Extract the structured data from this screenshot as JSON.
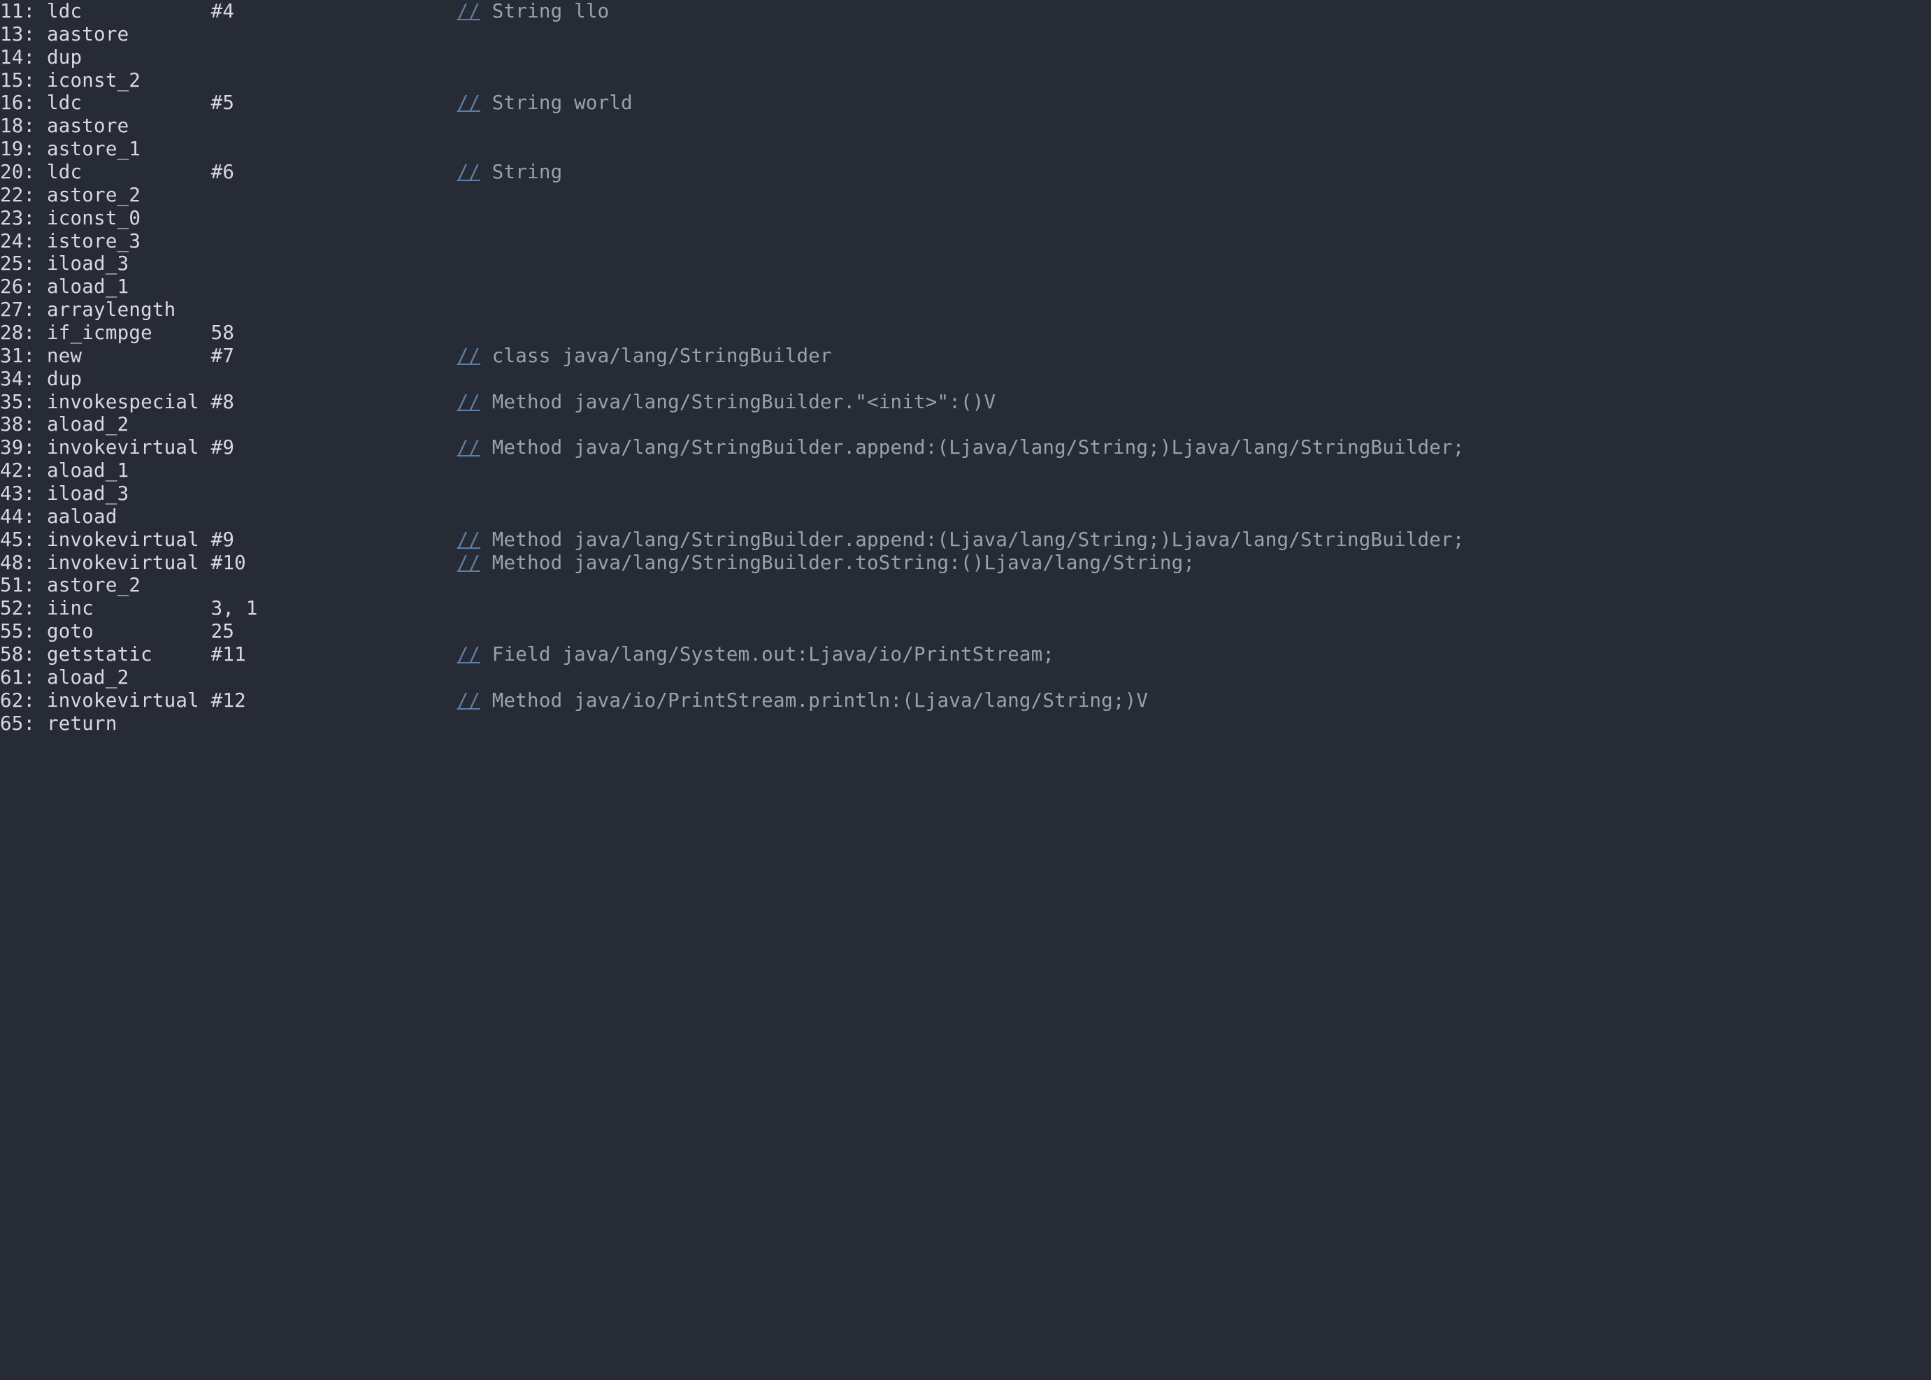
{
  "bytecode": {
    "rows": [
      {
        "offset": "11",
        "op": "ldc",
        "arg": "#4",
        "comment": "String llo"
      },
      {
        "offset": "13",
        "op": "aastore",
        "arg": "",
        "comment": ""
      },
      {
        "offset": "14",
        "op": "dup",
        "arg": "",
        "comment": ""
      },
      {
        "offset": "15",
        "op": "iconst_2",
        "arg": "",
        "comment": ""
      },
      {
        "offset": "16",
        "op": "ldc",
        "arg": "#5",
        "comment": "String world"
      },
      {
        "offset": "18",
        "op": "aastore",
        "arg": "",
        "comment": ""
      },
      {
        "offset": "19",
        "op": "astore_1",
        "arg": "",
        "comment": ""
      },
      {
        "offset": "20",
        "op": "ldc",
        "arg": "#6",
        "comment": "String"
      },
      {
        "offset": "22",
        "op": "astore_2",
        "arg": "",
        "comment": ""
      },
      {
        "offset": "23",
        "op": "iconst_0",
        "arg": "",
        "comment": ""
      },
      {
        "offset": "24",
        "op": "istore_3",
        "arg": "",
        "comment": ""
      },
      {
        "offset": "25",
        "op": "iload_3",
        "arg": "",
        "comment": ""
      },
      {
        "offset": "26",
        "op": "aload_1",
        "arg": "",
        "comment": ""
      },
      {
        "offset": "27",
        "op": "arraylength",
        "arg": "",
        "comment": ""
      },
      {
        "offset": "28",
        "op": "if_icmpge",
        "arg": "58",
        "comment": ""
      },
      {
        "offset": "31",
        "op": "new",
        "arg": "#7",
        "comment": "class java/lang/StringBuilder"
      },
      {
        "offset": "34",
        "op": "dup",
        "arg": "",
        "comment": ""
      },
      {
        "offset": "35",
        "op": "invokespecial",
        "arg": "#8",
        "comment": "Method java/lang/StringBuilder.\"<init>\":()V"
      },
      {
        "offset": "38",
        "op": "aload_2",
        "arg": "",
        "comment": ""
      },
      {
        "offset": "39",
        "op": "invokevirtual",
        "arg": "#9",
        "comment": "Method java/lang/StringBuilder.append:(Ljava/lang/String;)Ljava/lang/StringBuilder;"
      },
      {
        "offset": "42",
        "op": "aload_1",
        "arg": "",
        "comment": ""
      },
      {
        "offset": "43",
        "op": "iload_3",
        "arg": "",
        "comment": ""
      },
      {
        "offset": "44",
        "op": "aaload",
        "arg": "",
        "comment": ""
      },
      {
        "offset": "45",
        "op": "invokevirtual",
        "arg": "#9",
        "comment": "Method java/lang/StringBuilder.append:(Ljava/lang/String;)Ljava/lang/StringBuilder;"
      },
      {
        "offset": "48",
        "op": "invokevirtual",
        "arg": "#10",
        "comment": "Method java/lang/StringBuilder.toString:()Ljava/lang/String;"
      },
      {
        "offset": "51",
        "op": "astore_2",
        "arg": "",
        "comment": ""
      },
      {
        "offset": "52",
        "op": "iinc",
        "arg": "3, 1",
        "comment": ""
      },
      {
        "offset": "55",
        "op": "goto",
        "arg": "25",
        "comment": ""
      },
      {
        "offset": "58",
        "op": "getstatic",
        "arg": "#11",
        "comment": "Field java/lang/System.out:Ljava/io/PrintStream;"
      },
      {
        "offset": "61",
        "op": "aload_2",
        "arg": "",
        "comment": ""
      },
      {
        "offset": "62",
        "op": "invokevirtual",
        "arg": "#12",
        "comment": "Method java/io/PrintStream.println:(Ljava/lang/String;)V"
      },
      {
        "offset": "65",
        "op": "return",
        "arg": "",
        "comment": ""
      }
    ],
    "slash_token": "//"
  }
}
